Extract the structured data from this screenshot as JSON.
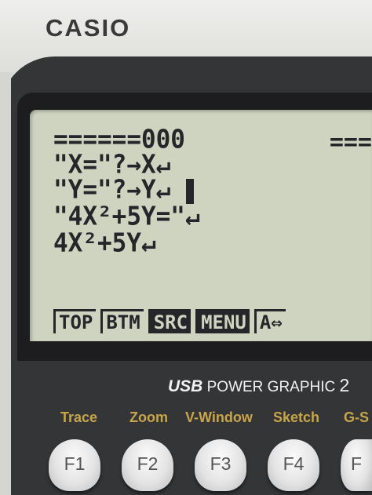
{
  "brand": "CASIO",
  "model": {
    "usb": "USB",
    "name": "POWER GRAPHIC",
    "num": "2"
  },
  "screen": {
    "lines": [
      "======000",
      "\"X=\"?→X↵",
      "\"Y=\"?→Y↵",
      "\"4X²+5Y=\"↵",
      "4X²+5Y↵"
    ],
    "edge_text": "===",
    "fkeys": [
      {
        "label": "TOP",
        "inverted": false
      },
      {
        "label": "BTM",
        "inverted": false
      },
      {
        "label": "SRC",
        "inverted": true
      },
      {
        "label": "MENU",
        "inverted": true
      },
      {
        "label": "A⇔",
        "inverted": false
      }
    ]
  },
  "function_labels": [
    "Trace",
    "Zoom",
    "V-Window",
    "Sketch",
    "G-S"
  ],
  "function_keys": [
    "F1",
    "F2",
    "F3",
    "F4",
    "F"
  ]
}
